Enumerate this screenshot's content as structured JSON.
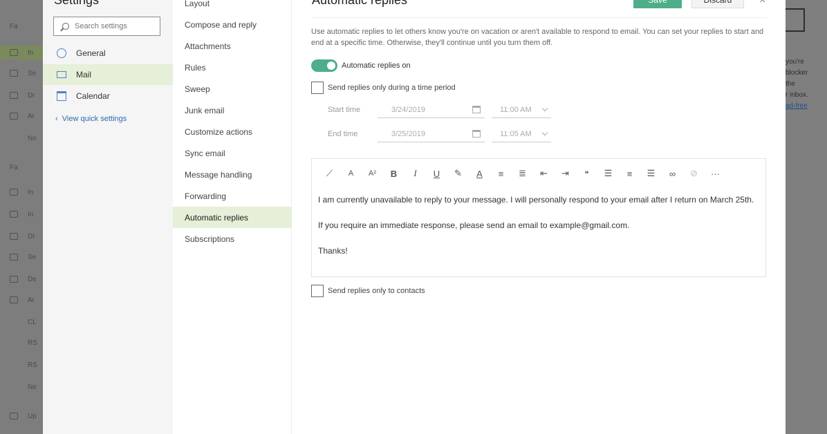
{
  "background_left": {
    "items": [
      "Fa",
      "In",
      "Se",
      "Dr",
      "Ar",
      "No",
      "Fa",
      "In",
      "In",
      "Dr",
      "Se",
      "De",
      "Ar",
      "CL",
      "RS",
      "RS",
      "Ne",
      "Up"
    ]
  },
  "background_right": {
    "lines": [
      "you're",
      "blocker",
      "the",
      "r inbox.",
      "ad-free"
    ]
  },
  "settings": {
    "title": "Settings",
    "search_placeholder": "Search settings",
    "nav": [
      {
        "label": "General",
        "icon": "gear-icon"
      },
      {
        "label": "Mail",
        "icon": "mail-icon"
      },
      {
        "label": "Calendar",
        "icon": "calendar-icon"
      }
    ],
    "view_quick_settings": "View quick settings"
  },
  "mail_menu": {
    "items": [
      "Layout",
      "Compose and reply",
      "Attachments",
      "Rules",
      "Sweep",
      "Junk email",
      "Customize actions",
      "Sync email",
      "Message handling",
      "Forwarding",
      "Automatic replies",
      "Subscriptions"
    ],
    "active_index": 10
  },
  "auto_replies": {
    "title": "Automatic replies",
    "save_label": "Save",
    "discard_label": "Discard",
    "close_glyph": "×",
    "description": "Use automatic replies to let others know you're on vacation or aren't available to respond to email. You can set your replies to start and end at a specific time. Otherwise, they'll continue until you turn them off.",
    "toggle_label": "Automatic replies on",
    "toggle_on": true,
    "time_period_label": "Send replies only during a time period",
    "start_time_label": "Start time",
    "start_date": "3/24/2019",
    "start_hour": "11:00 AM",
    "end_time_label": "End time",
    "end_date": "3/25/2019",
    "end_hour": "11:05 AM",
    "toolbar_icons": [
      "format-painter-icon",
      "font-size-icon",
      "superscript-icon",
      "bold-icon",
      "italic-icon",
      "underline-icon",
      "highlight-icon",
      "font-color-icon",
      "bullets-icon",
      "numbering-icon",
      "decrease-indent-icon",
      "increase-indent-icon",
      "quote-icon",
      "align-left-icon",
      "align-center-icon",
      "align-right-icon",
      "link-icon",
      "unlink-icon",
      "more-icon"
    ],
    "toolbar_glyphs": [
      "⟋",
      "A",
      "A²",
      "B",
      "I",
      "U",
      "✎",
      "A",
      "≡",
      "≣",
      "⇤",
      "⇥",
      "❝",
      "☰",
      "≡",
      "☰",
      "∞",
      "⊘",
      "···"
    ],
    "message_paragraphs": [
      "I am currently unavailable to reply to your message. I will personally respond to your email after I return on March 25th.",
      "If you require an immediate response, please send an email to example@gmail.com.",
      "Thanks!"
    ],
    "contacts_only_label": "Send replies only to contacts"
  },
  "colors": {
    "accent": "#4eae8a",
    "active_nav": "#e6efd8",
    "link": "#2b6cb0"
  }
}
